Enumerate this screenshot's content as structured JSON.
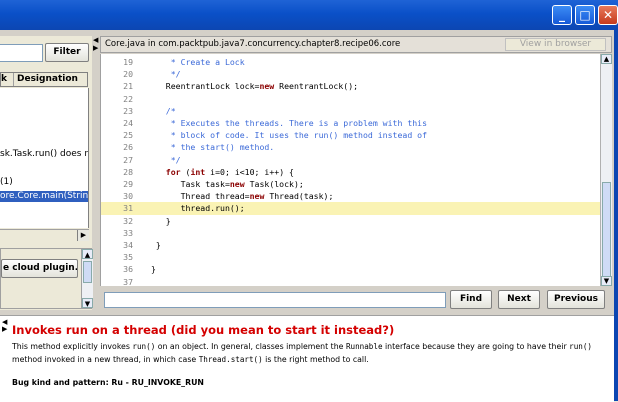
{
  "window": {
    "minimize_glyph": "_",
    "maximize_glyph": "□",
    "close_glyph": "✕"
  },
  "left_panel": {
    "filter_label": "Filter",
    "column_k": "k",
    "column_designation": "Designation",
    "rows": [
      "sk.Task.run() does not r",
      "(1)",
      "ore.Core.main(String[]) e"
    ],
    "plugin_button": "e cloud plugin..."
  },
  "editor": {
    "title": "Core.java in com.packtpub.java7.concurrency.chapter8.recipe06.core",
    "browser_button": "View in browser",
    "lines": [
      {
        "n": "19",
        "t": [
          {
            "c": "c",
            "s": "    * Create a Lock"
          }
        ]
      },
      {
        "n": "20",
        "t": [
          {
            "c": "c",
            "s": "    */"
          }
        ]
      },
      {
        "n": "21",
        "t": [
          {
            "c": "",
            "s": "   ReentrantLock lock="
          },
          {
            "c": "kw",
            "s": "new"
          },
          {
            "c": "",
            "s": " ReentrantLock();"
          }
        ]
      },
      {
        "n": "22",
        "t": [
          {
            "c": "",
            "s": ""
          }
        ]
      },
      {
        "n": "23",
        "t": [
          {
            "c": "c",
            "s": "   /*"
          }
        ]
      },
      {
        "n": "24",
        "t": [
          {
            "c": "c",
            "s": "    * Executes the threads. There is a problem with this"
          }
        ]
      },
      {
        "n": "25",
        "t": [
          {
            "c": "c",
            "s": "    * block of code. It uses the run() method instead of"
          }
        ]
      },
      {
        "n": "26",
        "t": [
          {
            "c": "c",
            "s": "    * the start() method."
          }
        ]
      },
      {
        "n": "27",
        "t": [
          {
            "c": "c",
            "s": "    */"
          }
        ]
      },
      {
        "n": "28",
        "t": [
          {
            "c": "",
            "s": "   "
          },
          {
            "c": "kw",
            "s": "for"
          },
          {
            "c": "",
            "s": " ("
          },
          {
            "c": "kw",
            "s": "int"
          },
          {
            "c": "",
            "s": " i=0; i<10; i++) {"
          }
        ]
      },
      {
        "n": "29",
        "t": [
          {
            "c": "",
            "s": "      Task task="
          },
          {
            "c": "kw",
            "s": "new"
          },
          {
            "c": "",
            "s": " Task(lock);"
          }
        ]
      },
      {
        "n": "30",
        "t": [
          {
            "c": "",
            "s": "      Thread thread="
          },
          {
            "c": "kw",
            "s": "new"
          },
          {
            "c": "",
            "s": " Thread(task);"
          }
        ]
      },
      {
        "n": "31",
        "t": [
          {
            "c": "",
            "s": "      thread.run();"
          }
        ],
        "hl": true
      },
      {
        "n": "32",
        "t": [
          {
            "c": "",
            "s": "   }"
          }
        ]
      },
      {
        "n": "33",
        "t": [
          {
            "c": "",
            "s": ""
          }
        ]
      },
      {
        "n": "34",
        "t": [
          {
            "c": "",
            "s": " }"
          }
        ]
      },
      {
        "n": "35",
        "t": [
          {
            "c": "",
            "s": ""
          }
        ]
      },
      {
        "n": "36",
        "t": [
          {
            "c": "",
            "s": "}"
          }
        ]
      },
      {
        "n": "37",
        "t": [
          {
            "c": "",
            "s": ""
          }
        ]
      }
    ]
  },
  "find_bar": {
    "find": "Find",
    "next": "Next",
    "previous": "Previous"
  },
  "bug": {
    "title": "Invokes run on a thread (did you mean to start it instead?)",
    "desc_1": "This method explicitly invokes ",
    "code_run": "run()",
    "desc_2": " on an object.  In general, classes implement the ",
    "code_runnable": "Runnable",
    "desc_3": " interface because they are going to have their ",
    "code_run2": "run()",
    "desc_4": " method invoked in a new thread, in which case ",
    "code_start": "Thread.start()",
    "desc_5": " is the right method to call.",
    "pattern": "Bug kind and pattern: Ru - RU_INVOKE_RUN"
  },
  "colors": {
    "title_red": "#d40000",
    "highlight_line": "#faf3b4",
    "comment_blue": "#3c6ad8",
    "keyword": "#8b0000"
  }
}
